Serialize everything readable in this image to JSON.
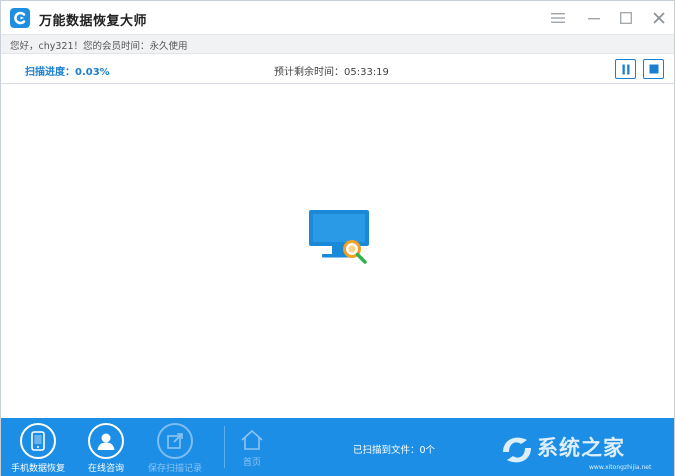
{
  "window": {
    "title": "万能数据恢复大师"
  },
  "greeting": {
    "text": "您好，chy321！您的会员时间：永久使用"
  },
  "progress": {
    "label": "扫描进度：0.03%",
    "value_percent": 0.03,
    "remaining": "预计剩余时间：05:33:19"
  },
  "toolbar": {
    "phone_recovery": "手机数据恢复",
    "online_consult": "在线咨询",
    "save_scan_record": "保存扫描记录",
    "home": "首页",
    "scanned_files": "已扫描到文件：0个"
  },
  "watermark": {
    "text": "系统之家",
    "url": "www.xitongzhijia.net"
  },
  "icons": {
    "app_logo": "app-logo-icon",
    "menu": "menu-icon",
    "minimize": "minimize-icon",
    "maximize": "maximize-icon",
    "close": "close-icon",
    "pause": "pause-icon",
    "stop": "stop-icon",
    "scan_illustration": "monitor-search-icon",
    "phone": "phone-icon",
    "user": "user-icon",
    "save": "export-icon",
    "home": "home-icon"
  },
  "colors": {
    "accent": "#1a7fd0",
    "toolbar_bg": "#1d8ee6",
    "magnifier": "#f0a020",
    "handle": "#2db34a"
  }
}
